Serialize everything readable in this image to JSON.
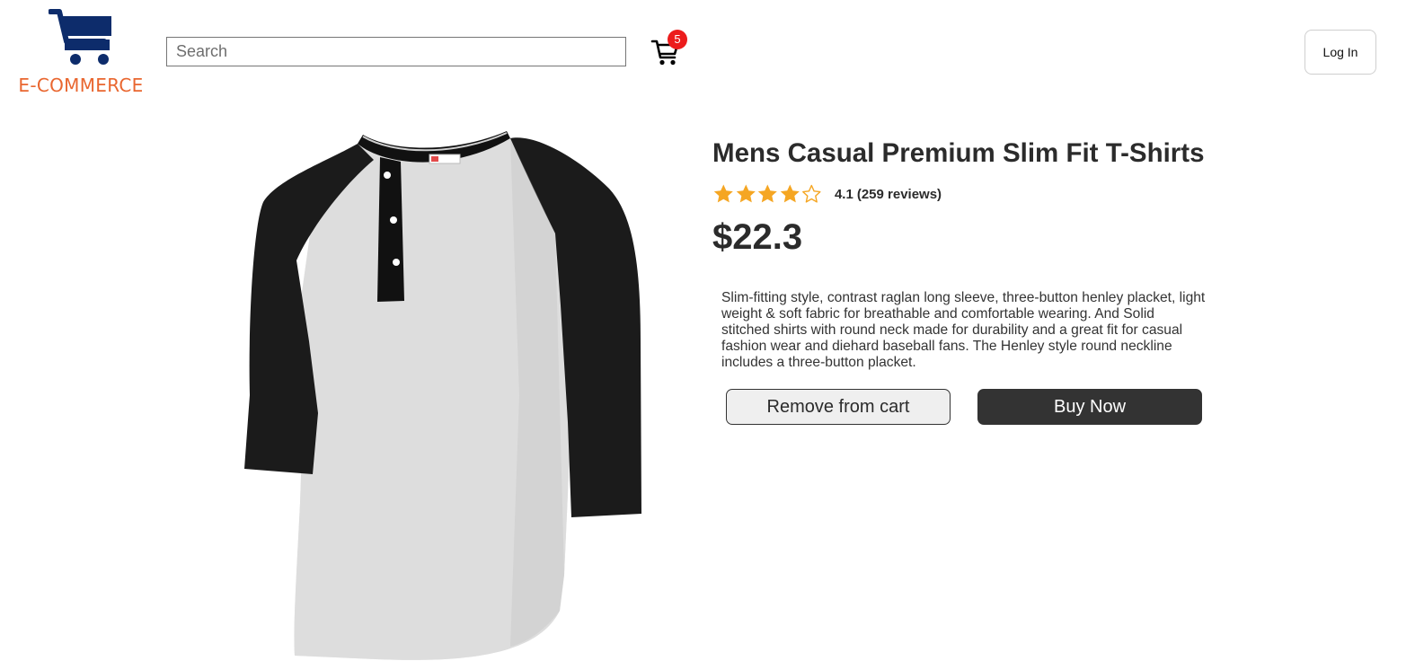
{
  "header": {
    "logo_text": "E-COMMERCE",
    "search_placeholder": "Search",
    "cart_count": "5",
    "login_label": "Log In"
  },
  "product": {
    "title": "Mens Casual Premium Slim Fit T-Shirts",
    "rating": "4.1",
    "reviews": "(259 reviews)",
    "stars_filled": 4,
    "stars_total": 5,
    "price": "$22.3",
    "description": "Slim-fitting style, contrast raglan long sleeve, three-button henley placket, light weight & soft fabric for breathable and comfortable wearing. And Solid stitched shirts with round neck made for durability and a great fit for casual fashion wear and diehard baseball fans. The Henley style round neckline includes a three-button placket.",
    "remove_label": "Remove from cart",
    "buy_label": "Buy Now"
  },
  "colors": {
    "brand_orange": "#e9662f",
    "brand_navy": "#0d2c6b",
    "star": "#f5a623",
    "badge": "#ec1c1c",
    "dark_button": "#333333"
  }
}
